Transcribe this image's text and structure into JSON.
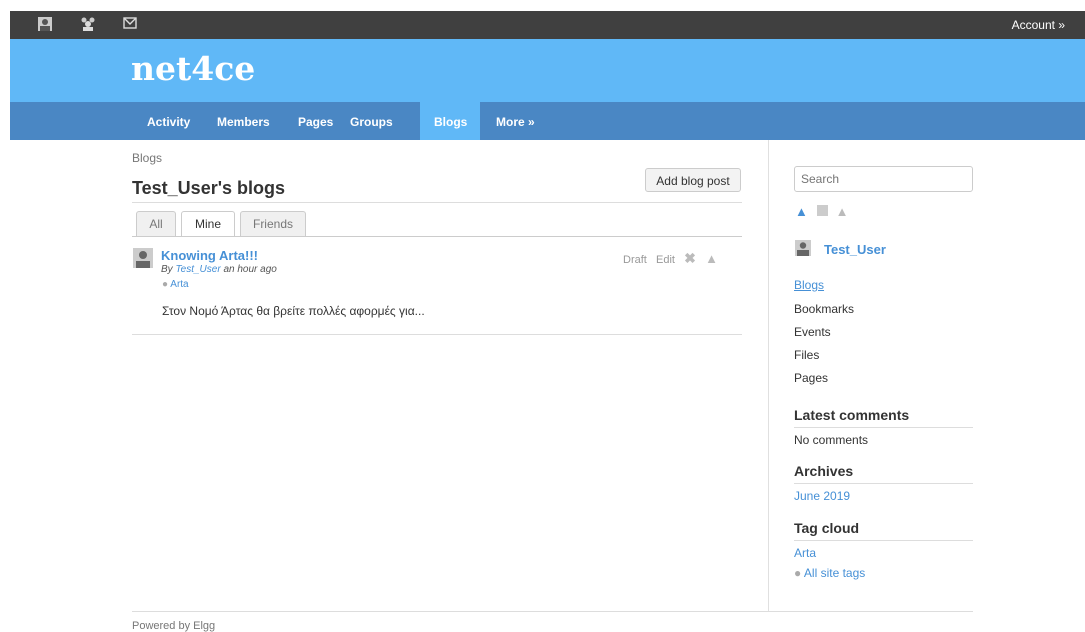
{
  "toolbar": {
    "icons": [
      "profile-icon",
      "friends-icon",
      "mail-icon"
    ],
    "account_label": "Account »"
  },
  "site": {
    "name": "net4ce"
  },
  "nav": {
    "items": [
      {
        "label": "Activity"
      },
      {
        "label": "Members"
      },
      {
        "label": "Pages"
      },
      {
        "label": "Groups"
      },
      {
        "label": "Blogs"
      },
      {
        "label": "More »"
      }
    ],
    "active": "Blogs"
  },
  "breadcrumb": "Blogs",
  "page_title": "Test_User's blogs",
  "add_button": "Add blog post",
  "tabs": [
    {
      "label": "All"
    },
    {
      "label": "Mine"
    },
    {
      "label": "Friends"
    }
  ],
  "post": {
    "title": "Knowing Arta!!!",
    "by_prefix": "By",
    "author": "Test_User",
    "time": "an hour ago",
    "tag": "Arta",
    "excerpt": "Στον Νομό Άρτας θα βρείτε πολλές αφορμές για...",
    "actions": {
      "draft": "Draft",
      "edit": "Edit"
    }
  },
  "sidebar": {
    "search_placeholder": "Search",
    "owner": "Test_User",
    "links": [
      {
        "label": "Blogs"
      },
      {
        "label": "Bookmarks"
      },
      {
        "label": "Events"
      },
      {
        "label": "Files"
      },
      {
        "label": "Pages"
      }
    ],
    "latest_comments": {
      "heading": "Latest comments",
      "text": "No comments"
    },
    "archives": {
      "heading": "Archives",
      "item": "June 2019"
    },
    "tag_cloud": {
      "heading": "Tag cloud",
      "tag": "Arta",
      "all_tags": "All site tags"
    }
  },
  "footer": "Powered by Elgg",
  "colors": {
    "toolbar": "#404040",
    "header": "#60b8f7",
    "nav": "#4a87c4",
    "link": "#4690d6"
  }
}
